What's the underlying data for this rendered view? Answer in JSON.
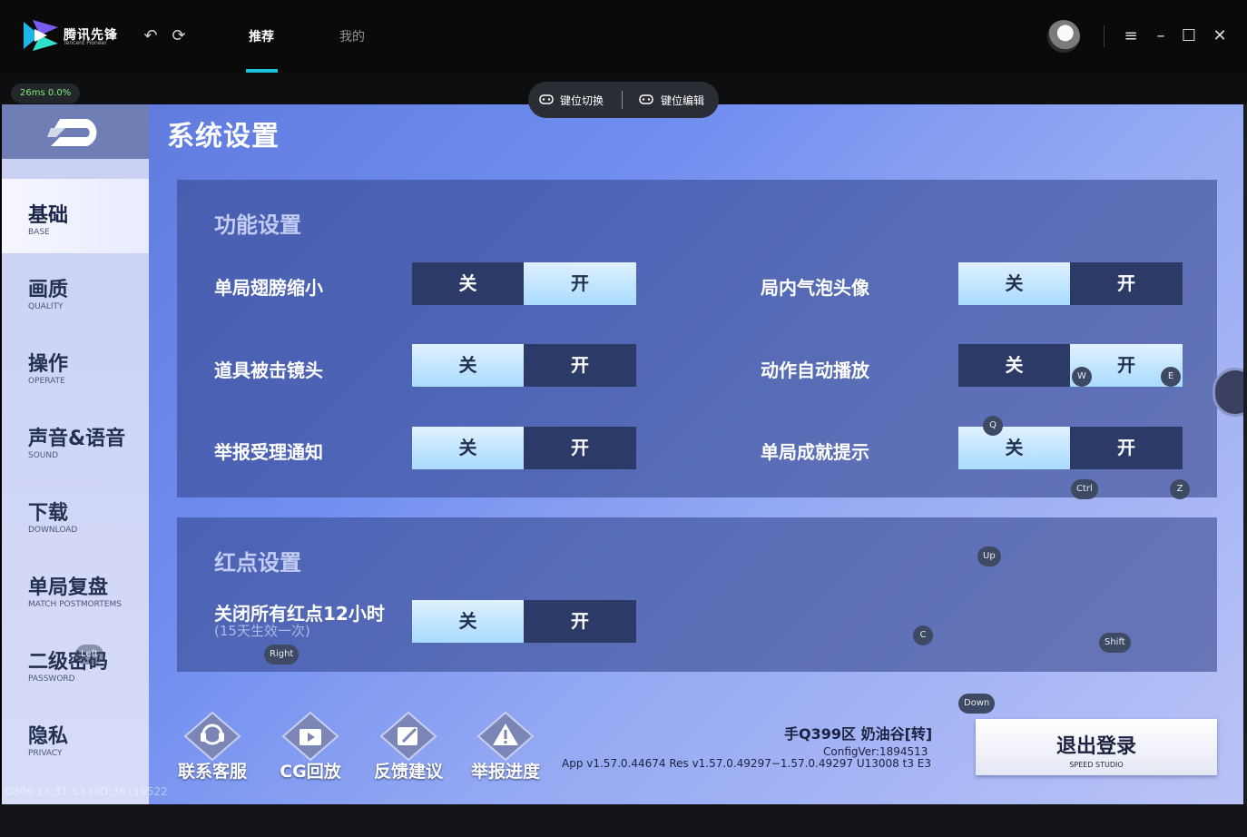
{
  "app": {
    "logo_text": "腾讯先锋",
    "logo_sub": "Tencent Pioneer",
    "tabs": [
      {
        "label": "推荐"
      },
      {
        "label": "我的"
      }
    ]
  },
  "overlay": {
    "ping": "26ms  0.0%",
    "key_switch": "键位切换",
    "key_edit": "键位编辑"
  },
  "game": {
    "page_title": "系统设置",
    "sidebar": [
      {
        "cn": "基础",
        "en": "BASE"
      },
      {
        "cn": "画质",
        "en": "QUALITY"
      },
      {
        "cn": "操作",
        "en": "OPERATE"
      },
      {
        "cn": "声音&语音",
        "en": "SOUND"
      },
      {
        "cn": "下载",
        "en": "DOWNLOAD"
      },
      {
        "cn": "单局复盘",
        "en": "MATCH POSTMORTEMS"
      },
      {
        "cn": "二级密码",
        "en": "PASSWORD"
      },
      {
        "cn": "隐私",
        "en": "PRIVACY"
      }
    ],
    "function_settings": {
      "title": "功能设置",
      "off_label": "关",
      "on_label": "开",
      "rows": [
        {
          "label": "单局翅膀缩小",
          "value": "开"
        },
        {
          "label": "局内气泡头像",
          "value": "关"
        },
        {
          "label": "道具被击镜头",
          "value": "关"
        },
        {
          "label": "动作自动播放",
          "value": "开"
        },
        {
          "label": "举报受理通知",
          "value": "关"
        },
        {
          "label": "单局成就提示",
          "value": "关"
        }
      ]
    },
    "red_dot_settings": {
      "title": "红点设置",
      "row_label": "关闭所有红点12小时",
      "row_sub": "(15天生效一次)",
      "value": "关"
    },
    "key_hints": [
      "Q",
      "W",
      "E",
      "Ctrl",
      "Z",
      "Up",
      "C",
      "Shift",
      "Down",
      "Right",
      "Left"
    ],
    "bottom_buttons": [
      {
        "label": "联系客服",
        "icon": "headset-icon"
      },
      {
        "label": "CG回放",
        "icon": "video-replay-icon"
      },
      {
        "label": "反馈建议",
        "icon": "feedback-pen-icon"
      },
      {
        "label": "举报进度",
        "icon": "warning-icon"
      }
    ],
    "server_info": "手Q399区 奶油谷[转]",
    "config_ver": "ConfigVer:1894513",
    "app_ver": "App v1.57.0.44674 Res v1.57.0.49297−1.57.0.49297 U13008 t3 E3",
    "logout": {
      "label": "退出登录",
      "sub": "SPEED STUDIO"
    },
    "uid_line": "0806 13:31:53 UID:36119522"
  }
}
